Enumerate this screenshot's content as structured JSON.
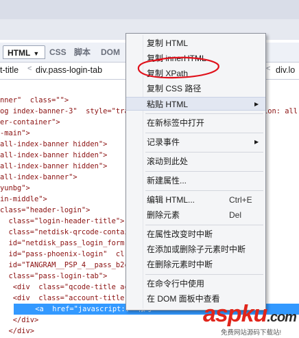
{
  "tabbar": {
    "tabs": [
      {
        "label": "HTML",
        "active": true
      },
      {
        "label": "CSS"
      },
      {
        "label": "脚本"
      },
      {
        "label": "DOM"
      }
    ]
  },
  "breadcrumb": {
    "items": [
      "t-title",
      "div.pass-login-tab",
      "div.lo"
    ]
  },
  "code_lines": [
    "nner\"  class=\"\">",
    "og index-banner-3\"  style=\"transf",
    "er-container\">",
    "-main\">",
    "all-index-banner hidden\">",
    "all-index-banner hidden\">",
    "all-index-banner hidden\">",
    "all-index-banner\">",
    "yunbg\">",
    "in-middle\">",
    "class=\"header-login\">",
    "  class=\"login-header-title\">",
    "  class=\"netdisk-qrcode-container",
    "  id=\"netdisk_pass_login_form\"  c",
    "  id=\"pass-phoenix-login\"  cl",
    "  id=\"TANGRAM__PSP_4__pass_b2c\"",
    "  class=\"pass-login-tab\">",
    "   <div  class=\"qcode-title active\"",
    "   <div  class=\"account-title\">",
    "     <a  href=\"javascript::\">帐号",
    "   </div>",
    "  </div>",
    "  <div  class=\"qc"
  ],
  "code_right_fragment": "ion: all",
  "context_menu": {
    "items": [
      {
        "label": "复制 HTML"
      },
      {
        "label": "复制 innerHTML"
      },
      {
        "label": "复制 XPath"
      },
      {
        "label": "复制 CSS 路径"
      },
      {
        "label": "粘贴 HTML",
        "submenu": true
      },
      {
        "label": "在新标签中打开"
      },
      {
        "label": "记录事件",
        "submenu": true
      },
      {
        "label": "滚动到此处"
      },
      {
        "label": "新建属性..."
      },
      {
        "label": "编辑 HTML...",
        "shortcut": "Ctrl+E"
      },
      {
        "label": "删除元素",
        "shortcut": "Del"
      },
      {
        "label": "在属性改变时中断"
      },
      {
        "label": "在添加或删除子元素时中断"
      },
      {
        "label": "在删除元素时中断"
      },
      {
        "label": "在命令行中使用"
      },
      {
        "label": "在 DOM 面板中查看"
      }
    ]
  },
  "watermark": {
    "brand": "aspku",
    "suffix": ".com",
    "tagline": "免费网站源码下载站!"
  },
  "colors": {
    "code_text": "#8a1010",
    "highlight": "#3399ff",
    "annotation": "#e0101a",
    "watermark_red": "#e0251b",
    "watermark_dark": "#2b2b2b"
  }
}
